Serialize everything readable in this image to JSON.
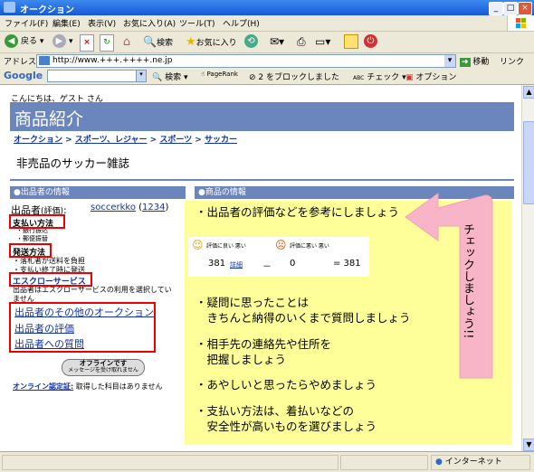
{
  "window": {
    "title": "オークション"
  },
  "menubar": {
    "items": [
      "ファイル(F)",
      "編集(E)",
      "表示(V)",
      "お気に入り(A)",
      "ツール(T)",
      "ヘルプ(H)"
    ]
  },
  "toolbar": {
    "back": "戻る",
    "search": "検索",
    "favorites": "お気に入り"
  },
  "address": {
    "label": "アドレス(D)",
    "url": "http://www.+++.++++.ne.jp",
    "go": "移動",
    "links": "リンク"
  },
  "googlebar": {
    "logo": "Google",
    "search": "検索",
    "pagerank": "PageRank",
    "blocked": "2 をブロックしました",
    "check": "チェック",
    "options": "オプション"
  },
  "page": {
    "welcome": "こんにちは、ゲスト さん",
    "banner": "商品紹介",
    "breadcrumb": [
      "オークション",
      "スポーツ、レジャー",
      "スポーツ",
      "サッカー"
    ],
    "crumb_sep": ">",
    "item_title": "非売品のサッカー雑誌",
    "seller_header": "●出品者の情報",
    "item_header": "●商品の情報",
    "seller_label": "出品者",
    "seller_eval_label": "(評価)",
    "seller_name": "soccerkko",
    "seller_rating": "1234",
    "payment_label": "支払い方法",
    "payment_items": [
      "・銀行振込",
      "・郵便振替"
    ],
    "shipping_label": "発送方法",
    "shipping_items": [
      "・落札者が送料を負担",
      "・支払い終了時に発送"
    ],
    "escrow_label": "エスクローサービス",
    "escrow_note": "出品者はエスクローサービスの利用を選択してい",
    "escrow_note2": "ません",
    "links": [
      "出品者のその他のオークション",
      "出品者の評価",
      "出品者への質問"
    ],
    "offline_btn1": "オフラインです",
    "offline_btn2": "メッセージを受け取れません",
    "online_label": "オンライン認定証:",
    "online_text": "取得した科目はありません"
  },
  "eval": {
    "good_label": "評価に良い 悪い",
    "bad_label": "評価に悪い 悪い",
    "good": "381",
    "detail": "詳細",
    "minus": "－",
    "bad": "0",
    "equals": "= 381"
  },
  "tips": [
    "・出品者の評価などを参考にしましょう",
    "・疑問に思ったことは",
    "　きちんと納得のいくまで質問しましょう",
    "・相手先の連絡先や住所を",
    "　把握しましょう",
    "・あやしいと思ったらやめましょう",
    "・支払い方法は、着払いなどの",
    "　安全性が高いものを選びましょう"
  ],
  "arrow_text": "チェックしましょう!!",
  "statusbar": {
    "zone": "インターネット"
  },
  "colors": {
    "banner": "#6b85bd",
    "highlight": "#ffff99",
    "annotation_red": "#ee0000",
    "arrow_pink": "#f9b5c8"
  }
}
